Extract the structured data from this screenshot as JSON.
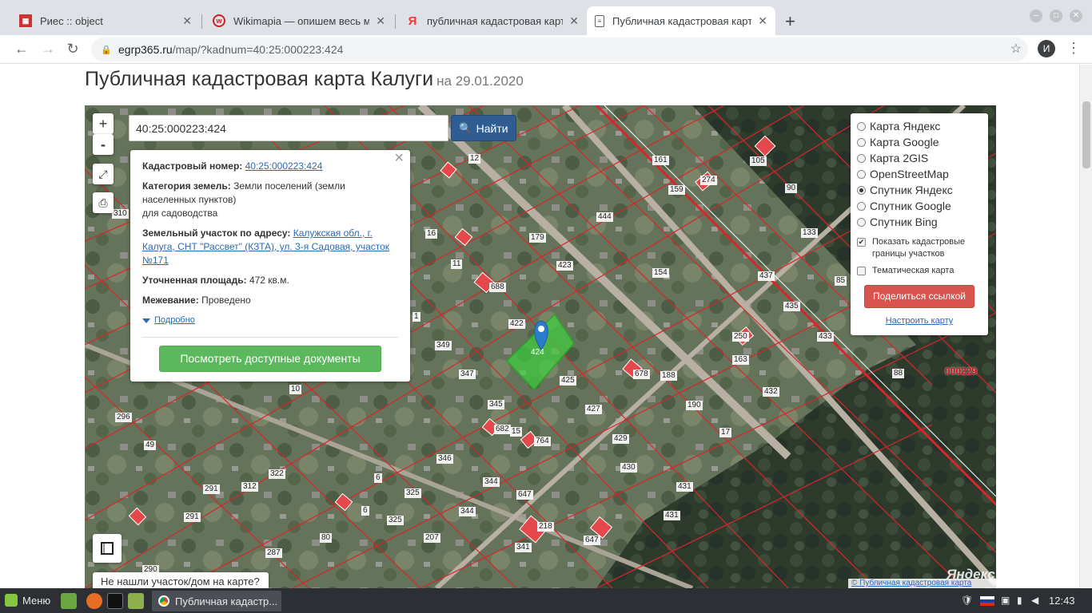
{
  "browser": {
    "tabs": [
      {
        "title": "Риес :: object",
        "icon": "grid-favicon"
      },
      {
        "title": "Wikimapia — опишем весь ми",
        "icon": "wikimapia-favicon"
      },
      {
        "title": "публичная кадастровая карт",
        "icon": "yandex-favicon"
      },
      {
        "title": "Публичная кадастровая карт",
        "icon": "page-favicon"
      }
    ],
    "url_host": "egrp365.ru",
    "url_path": "/map/?kadnum=40:25:000223:424",
    "avatar_letter": "И"
  },
  "page": {
    "title": "Публичная кадастровая карта Калуги",
    "date": "на 29.01.2020"
  },
  "map": {
    "zoom_in": "+",
    "zoom_out": "-",
    "search_value": "40:25:000223:424",
    "search_button": "Найти",
    "block_code": "000229",
    "yandex_logo": "Яндекс",
    "copyright": "© Публичная кадастровая карта",
    "not_found": "Не нашли участок/дом на карте?",
    "selected_parcel": "424",
    "parcel_labels": [
      "12",
      "161",
      "105",
      "90",
      "159",
      "274",
      "310",
      "16",
      "179",
      "444",
      "133",
      "11",
      "423",
      "154",
      "437",
      "85",
      "688",
      "1",
      "422",
      "435",
      "433",
      "349",
      "250",
      "163",
      "88",
      "347",
      "678",
      "188",
      "425",
      "432",
      "10",
      "345",
      "427",
      "190",
      "296",
      "682",
      "15",
      "764",
      "429",
      "17",
      "49",
      "346",
      "430",
      "6",
      "322",
      "344",
      "647",
      "431",
      "291",
      "325",
      "312",
      "6",
      "344",
      "431",
      "291",
      "325",
      "207",
      "341",
      "218",
      "647",
      "292",
      "80",
      "290",
      "287"
    ]
  },
  "info": {
    "cadastral_label": "Кадастровый номер:",
    "cadastral_value": "40:25:000223:424",
    "category_label": "Категория земель:",
    "category_value": "Земли поселений (земли населенных пунктов)",
    "category_use": "для садоводства",
    "address_label": "Земельный участок по адресу:",
    "address_value": "Калужская обл., г. Калуга, СНТ \"Рассвет\" (КЗТА), ул. 3-я Садовая, участок №171",
    "area_label": "Уточненная площадь:",
    "area_value": "472 кв.м.",
    "survey_label": "Межевание:",
    "survey_value": "Проведено",
    "more": "Подробно",
    "docs_button": "Посмотреть доступные документы"
  },
  "layers": {
    "options": [
      {
        "label": "Карта Яндекс",
        "selected": false
      },
      {
        "label": "Карта Google",
        "selected": false
      },
      {
        "label": "Карта 2GIS",
        "selected": false
      },
      {
        "label": "OpenStreetMap",
        "selected": false
      },
      {
        "label": "Спутник Яндекс",
        "selected": true
      },
      {
        "label": "Спутник Google",
        "selected": false
      },
      {
        "label": "Спутник Bing",
        "selected": false
      }
    ],
    "show_borders": "Показать кадастровые границы участков",
    "show_borders_checked": true,
    "thematic": "Тематическая карта",
    "thematic_checked": false,
    "share_button": "Поделиться ссылкой",
    "configure_link": "Настроить карту"
  },
  "taskbar": {
    "menu": "Меню",
    "window_title": "Публичная кадастр...",
    "clock": "12:43"
  },
  "colors": {
    "parcel_border": "#d8262a",
    "selected_parcel": "#3fd13f",
    "marker": "#2a7dcd",
    "search_button": "#2f5d91",
    "docs_button": "#5cb85c",
    "share_button": "#d9534f"
  }
}
